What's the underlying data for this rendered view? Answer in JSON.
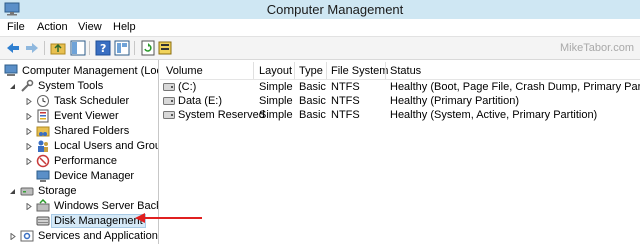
{
  "window": {
    "title": "Computer Management"
  },
  "menu": {
    "items": [
      "File",
      "Action",
      "View",
      "Help"
    ]
  },
  "toolbar": {
    "watermark": "MikeTabor.com"
  },
  "tree": {
    "root": "Computer Management (Local",
    "system_tools": "System Tools",
    "task_scheduler": "Task Scheduler",
    "event_viewer": "Event Viewer",
    "shared_folders": "Shared Folders",
    "local_users": "Local Users and Groups",
    "performance": "Performance",
    "device_manager": "Device Manager",
    "storage": "Storage",
    "windows_server_backup": "Windows Server Backup",
    "disk_management": "Disk Management",
    "services_apps": "Services and Applications"
  },
  "volumes": {
    "columns": [
      "Volume",
      "Layout",
      "Type",
      "File System",
      "Status"
    ],
    "rows": [
      {
        "volume": "(C:)",
        "layout": "Simple",
        "type": "Basic",
        "fs": "NTFS",
        "status": "Healthy (Boot, Page File, Crash Dump, Primary Partition)"
      },
      {
        "volume": "Data (E:)",
        "layout": "Simple",
        "type": "Basic",
        "fs": "NTFS",
        "status": "Healthy (Primary Partition)"
      },
      {
        "volume": "System Reserved",
        "layout": "Simple",
        "type": "Basic",
        "fs": "NTFS",
        "status": "Healthy (System, Active, Primary Partition)"
      }
    ]
  },
  "colors": {
    "titlebar": "#cfe7f3",
    "accent_arrow": "#e02020",
    "selection": "#d5e9f7"
  }
}
